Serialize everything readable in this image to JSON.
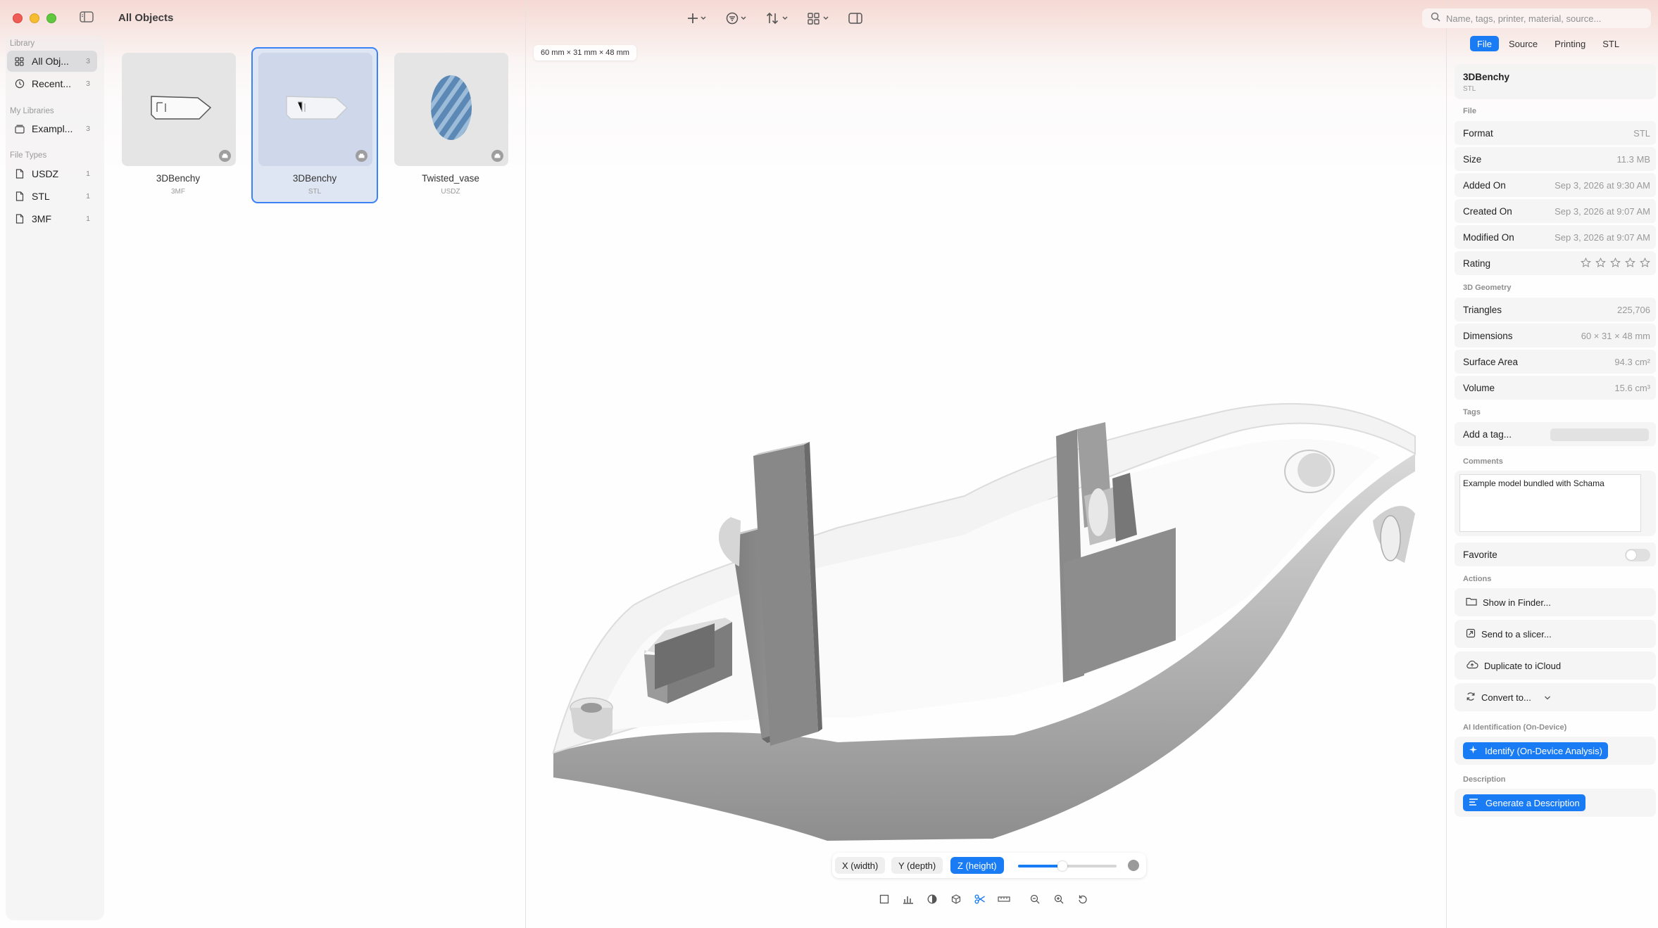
{
  "window": {
    "title": "All Objects"
  },
  "sidebar": {
    "sections": [
      {
        "title": "Library"
      },
      {
        "title": "My Libraries"
      },
      {
        "title": "File Types"
      }
    ],
    "items": [
      {
        "label": "All Obj...",
        "count": "3",
        "icon": "grid-icon",
        "active": true
      },
      {
        "label": "Recent...",
        "count": "3",
        "icon": "clock-icon"
      },
      {
        "label": "Exampl...",
        "count": "3",
        "icon": "library-icon"
      },
      {
        "label": "USDZ",
        "count": "1",
        "icon": "document-icon"
      },
      {
        "label": "STL",
        "count": "1",
        "icon": "document-icon"
      },
      {
        "label": "3MF",
        "count": "1",
        "icon": "document-icon"
      }
    ]
  },
  "grid": {
    "items": [
      {
        "name": "3DBenchy",
        "type": "3MF",
        "selected": false
      },
      {
        "name": "3DBenchy",
        "type": "STL",
        "selected": true
      },
      {
        "name": "Twisted_vase",
        "type": "USDZ",
        "selected": false
      }
    ]
  },
  "toolbar": {
    "buttons": [
      "add-icon",
      "filter-icon",
      "sort-icon",
      "view-mode-icon",
      "inspector-toggle-icon"
    ]
  },
  "search": {
    "placeholder": "Name, tags, printer, material, source..."
  },
  "viewer": {
    "dimensions": "60 mm × 31 mm × 48 mm",
    "axes": [
      {
        "label": "X (width)",
        "active": false
      },
      {
        "label": "Y (depth)",
        "active": false
      },
      {
        "label": "Z (height)",
        "active": true
      }
    ],
    "slider_value": 0.45,
    "tools": [
      "frame-icon",
      "chart-icon",
      "contrast-icon",
      "cube-icon",
      "scissors-icon",
      "ruler-icon",
      "zoom-out-icon",
      "zoom-in-icon",
      "reset-icon"
    ]
  },
  "inspector": {
    "tabs": [
      {
        "label": "File",
        "active": true
      },
      {
        "label": "Source"
      },
      {
        "label": "Printing"
      },
      {
        "label": "STL"
      }
    ],
    "name": "3DBenchy",
    "type": "STL",
    "sections": {
      "file": "File",
      "geometry": "3D Geometry",
      "tags": "Tags",
      "comments": "Comments",
      "actions": "Actions",
      "ai": "AI Identification (On-Device)",
      "description": "Description"
    },
    "file_rows": [
      {
        "key": "Format",
        "value": "STL"
      },
      {
        "key": "Size",
        "value": "11.3 MB"
      },
      {
        "key": "Added On",
        "value": "Sep 3, 2026 at 9:30 AM"
      },
      {
        "key": "Created On",
        "value": "Sep 3, 2026 at 9:07 AM"
      },
      {
        "key": "Modified On",
        "value": "Sep 3, 2026 at 9:07 AM"
      }
    ],
    "rating": {
      "label": "Rating",
      "value": 0,
      "max": 5
    },
    "geometry_rows": [
      {
        "key": "Triangles",
        "value": "225,706"
      },
      {
        "key": "Dimensions",
        "value": "60 × 31 × 48 mm"
      },
      {
        "key": "Surface Area",
        "value": "94.3 cm²"
      },
      {
        "key": "Volume",
        "value": "15.6 cm³"
      }
    ],
    "tag_placeholder": "Add a tag...",
    "comment": "Example model bundled with Schama",
    "favorite": {
      "label": "Favorite",
      "on": false
    },
    "actions": [
      {
        "label": "Show in Finder...",
        "icon": "folder-icon"
      },
      {
        "label": "Send to a slicer...",
        "icon": "slicer-icon"
      },
      {
        "label": "Duplicate to iCloud",
        "icon": "cloud-upload-icon"
      },
      {
        "label": "Convert to...",
        "icon": "convert-icon"
      }
    ],
    "identify_label": "Identify (On-Device Analysis)",
    "describe_label": "Generate a Description"
  },
  "colors": {
    "accent": "#1a7cf5",
    "selection": "#3b82f6"
  }
}
